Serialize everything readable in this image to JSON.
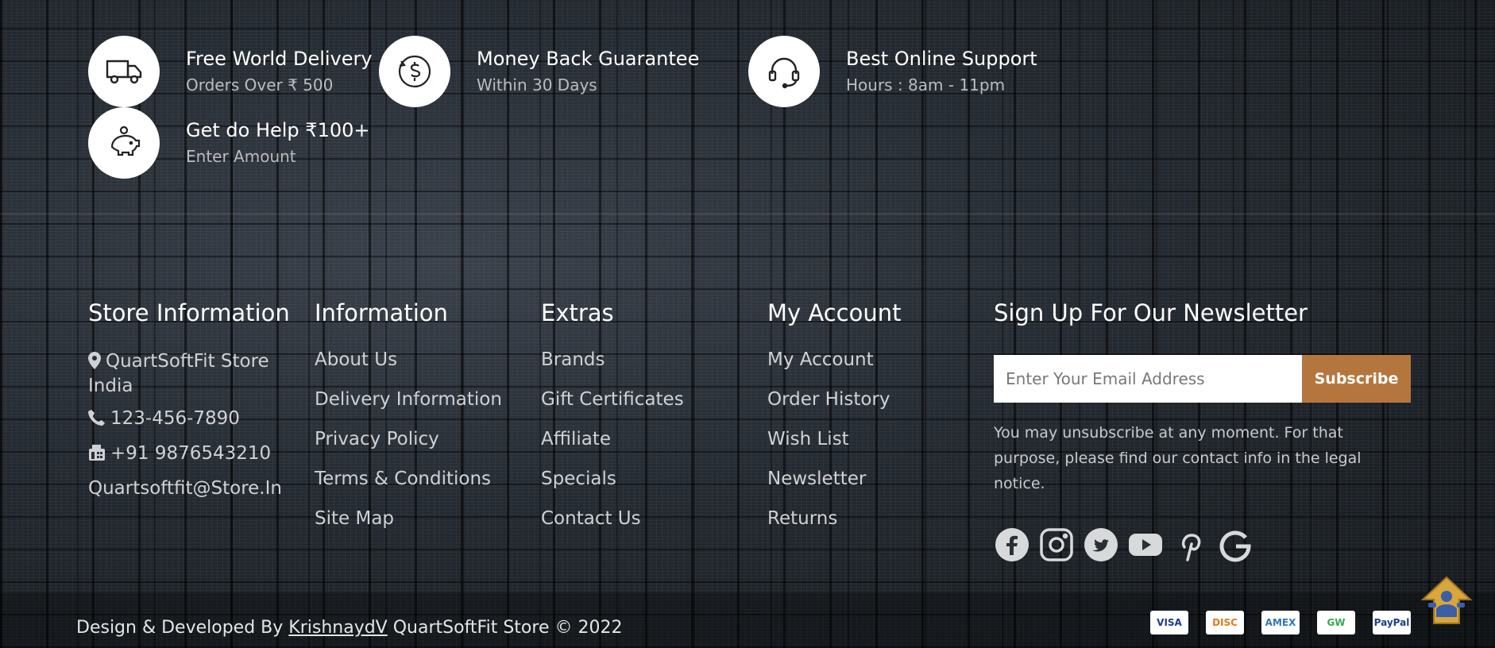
{
  "features": [
    {
      "title": "Free World Delivery",
      "subtitle": "Orders Over ₹ 500",
      "icon": "truck-icon"
    },
    {
      "title": "Money Back Guarantee",
      "subtitle": "Within 30 Days",
      "icon": "money-back-icon"
    },
    {
      "title": "Best Online Support",
      "subtitle": "Hours : 8am - 11pm",
      "icon": "headset-icon"
    },
    {
      "title": "Get do Help ₹100+",
      "subtitle": "Enter Amount",
      "icon": "piggy-bank-icon"
    }
  ],
  "store_info": {
    "heading": "Store Information",
    "address": "QuartSoftFit Store India",
    "phone": "123-456-7890",
    "fax": "+91 9876543210",
    "email": "Quartsoftfit@Store.In"
  },
  "information": {
    "heading": "Information",
    "links": [
      "About Us",
      "Delivery Information",
      "Privacy Policy",
      "Terms & Conditions",
      "Site Map"
    ]
  },
  "extras": {
    "heading": "Extras",
    "links": [
      "Brands",
      "Gift Certificates",
      "Affiliate",
      "Specials",
      "Contact Us"
    ]
  },
  "my_account": {
    "heading": "My Account",
    "links": [
      "My Account",
      "Order History",
      "Wish List",
      "Newsletter",
      "Returns"
    ]
  },
  "newsletter": {
    "heading": "Sign Up For Our Newsletter",
    "placeholder": "Enter Your Email Address",
    "button": "Subscribe",
    "note": "You may unsubscribe at any moment. For that purpose, please find our contact info in the legal notice.",
    "social": [
      "facebook-icon",
      "instagram-icon",
      "twitter-icon",
      "youtube-icon",
      "pinterest-icon",
      "google-icon"
    ]
  },
  "footer": {
    "credit_prefix": "Design & Developed By",
    "credit_link": "KrishnaydV",
    "credit_suffix": "QuartSoftFit Store © 2022",
    "payments": [
      {
        "name": "visa-icon",
        "label": "VISA",
        "color": "#1a3a8f"
      },
      {
        "name": "discover-icon",
        "label": "DISC",
        "color": "#e07a1f"
      },
      {
        "name": "amex-icon",
        "label": "AMEX",
        "color": "#2e77bb"
      },
      {
        "name": "google-wallet-icon",
        "label": "GW",
        "color": "#34a853"
      },
      {
        "name": "paypal-icon",
        "label": "PayPal",
        "color": "#1f3d8a"
      }
    ]
  },
  "colors": {
    "accent": "#b5763d",
    "background": "#1e2329"
  }
}
